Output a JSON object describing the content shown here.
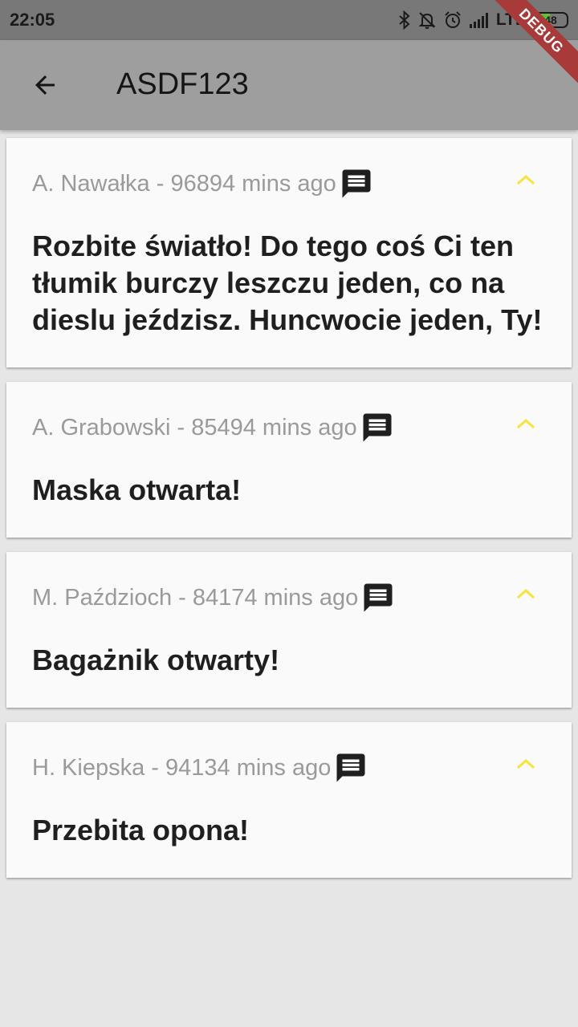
{
  "status_bar": {
    "time": "22:05",
    "network": "LTE",
    "battery_level": "48",
    "battery_fraction": 0.48,
    "icons": [
      "bluetooth-icon",
      "muted-bell-icon",
      "alarm-icon",
      "signal-icon"
    ]
  },
  "app_bar": {
    "title": "ASDF123",
    "back_icon": "arrow-left-icon"
  },
  "debug_banner": "DEBUG",
  "colors": {
    "status_bar": "#787878",
    "app_bar": "#9e9e9e",
    "background": "#e6e6e6",
    "card": "#fafafa",
    "meta_text": "#9a9a9a",
    "message_text": "#1f1f1f",
    "chevron": "#f7e33a",
    "debug_banner": "#a83a3a",
    "battery": "#5fc235"
  },
  "posts": [
    {
      "meta": "A. Nawałka - 96894 mins ago",
      "message_lines": [
        "Rozbite światło! Do tego coś Ci ten",
        "tłumik burczy leszczu jeden, co na",
        "dieslu jeździsz. Huncwocie jeden, Ty!"
      ]
    },
    {
      "meta": "A. Grabowski - 85494 mins ago",
      "message_lines": [
        "Maska otwarta!"
      ]
    },
    {
      "meta": "M. Paździoch - 84174 mins ago",
      "message_lines": [
        "Bagażnik otwarty!"
      ]
    },
    {
      "meta": "H. Kiepska - 94134 mins ago",
      "message_lines": [
        "Przebita opona!"
      ]
    }
  ]
}
